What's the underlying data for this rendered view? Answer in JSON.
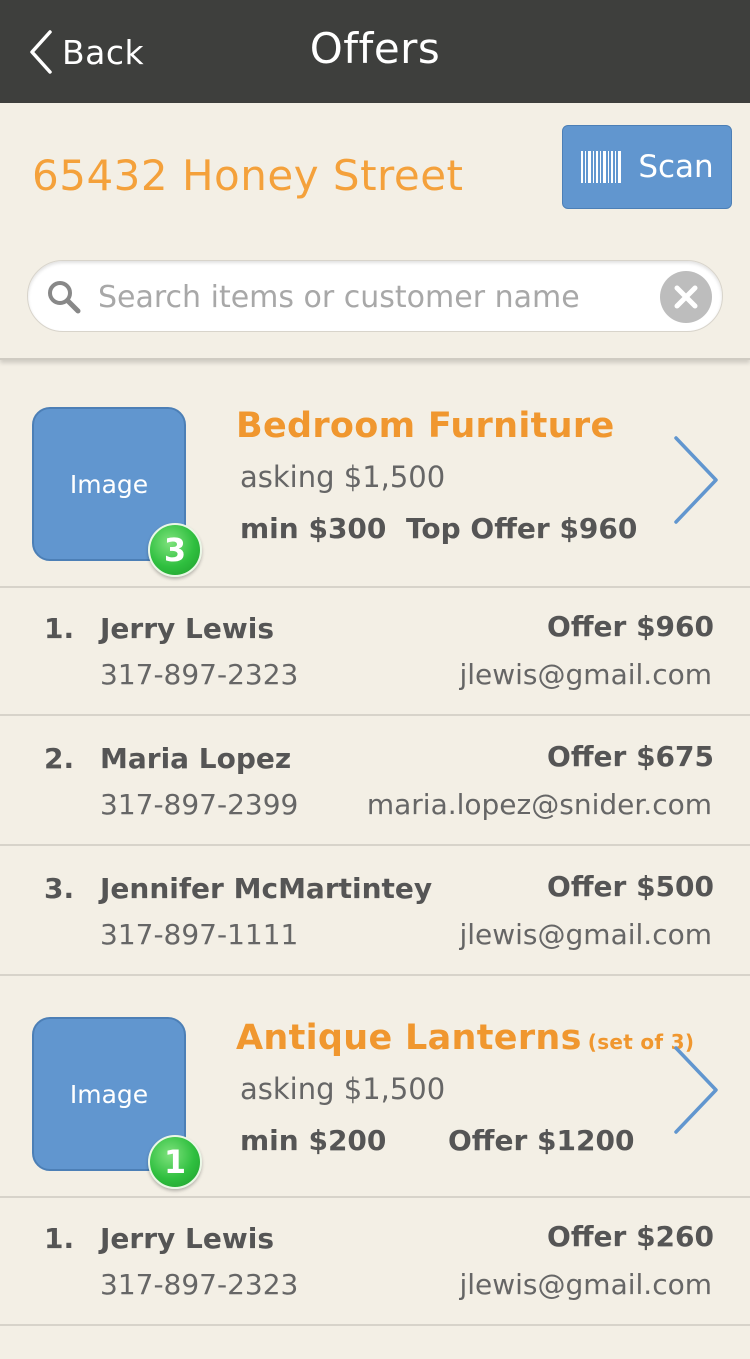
{
  "nav": {
    "back_label": "Back",
    "title": "Offers"
  },
  "header": {
    "address": "65432 Honey Street",
    "scan_label": "Scan"
  },
  "search": {
    "placeholder": "Search items or customer name",
    "value": ""
  },
  "colors": {
    "nav_bg": "#3e3f3d",
    "accent_orange": "#f0972f",
    "button_blue": "#6196cf",
    "badge_green": "#2fbf3f",
    "background": "#f3efe5"
  },
  "items": [
    {
      "title": "Bedroom Furniture",
      "subtitle": "",
      "image_label": "Image",
      "badge": "3",
      "asking": "asking $1,500",
      "min": "min $300",
      "offer_summary": "Top Offer $960",
      "offers": [
        {
          "rank": "1.",
          "name": "Jerry Lewis",
          "phone": "317-897-2323",
          "amount": "Offer $960",
          "email": "jlewis@gmail.com"
        },
        {
          "rank": "2.",
          "name": "Maria Lopez",
          "phone": "317-897-2399",
          "amount": "Offer $675",
          "email": "maria.lopez@snider.com"
        },
        {
          "rank": "3.",
          "name": "Jennifer McMartintey",
          "phone": "317-897-1111",
          "amount": "Offer $500",
          "email": "jlewis@gmail.com"
        }
      ]
    },
    {
      "title": "Antique Lanterns",
      "subtitle": "(set of 3)",
      "image_label": "Image",
      "badge": "1",
      "asking": "asking $1,500",
      "min": "min $200",
      "offer_summary": "Offer $1200",
      "offers": [
        {
          "rank": "1.",
          "name": "Jerry Lewis",
          "phone": "317-897-2323",
          "amount": "Offer $260",
          "email": "jlewis@gmail.com"
        }
      ]
    }
  ]
}
